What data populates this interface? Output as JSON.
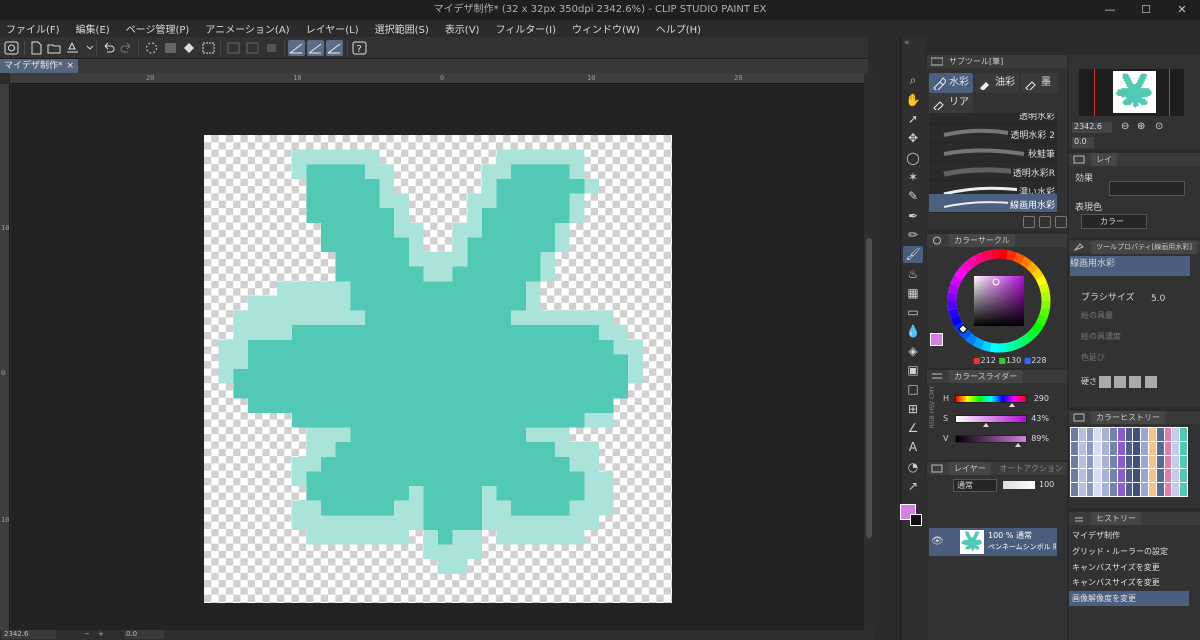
{
  "window": {
    "title": "マイデザ制作* (32 x 32px 350dpi 2342.6%)  - CLIP STUDIO PAINT EX",
    "minimize": "—",
    "maximize": "☐",
    "close": "✕"
  },
  "menu": [
    "ファイル(F)",
    "編集(E)",
    "ページ管理(P)",
    "アニメーション(A)",
    "レイヤー(L)",
    "選択範囲(S)",
    "表示(V)",
    "フィルター(I)",
    "ウィンドウ(W)",
    "ヘルプ(H)"
  ],
  "document_tab": {
    "label": "マイデザ制作*",
    "close": "×"
  },
  "rulers": {
    "horizontal": [
      "20",
      "10",
      "0",
      "10",
      "20"
    ],
    "vertical": [
      "10",
      "0",
      "10"
    ]
  },
  "status": {
    "zoom": "2342.6",
    "rotation": "0.0"
  },
  "colors": {
    "art": "#52c9b5",
    "art_edge": "#a9e3da",
    "accent": "#4b5f80",
    "current_color": "#d480e0"
  },
  "subtool_panel": {
    "title": "サブツール[筆]",
    "tabs": [
      "水彩",
      "油彩",
      "墨"
    ],
    "tab2": [
      "リアル"
    ],
    "brushes": [
      "透明水彩",
      "透明水彩 2",
      "秋鮭筆",
      "透明水彩R",
      "濃い水彩",
      "線画用水彩"
    ],
    "selected_brush": "線画用水彩"
  },
  "navigator": {
    "zoom": "2342.6",
    "angle": "0.0"
  },
  "layer_property": {
    "tab": "レイ",
    "effect_label": "効果",
    "expression_label": "表現色",
    "expression_value": "カラー"
  },
  "color_circle": {
    "title": "カラーサークル",
    "r": "212",
    "g": "130",
    "b": "228"
  },
  "tool_property": {
    "title": "ツールプロパティ[線画用水彩]",
    "brush_name": "線画用水彩",
    "brush_size_label": "ブラシサイズ",
    "brush_size_value": "5.0",
    "paint_amount": "絵の具量",
    "paint_density": "絵の具濃度",
    "color_stretch": "色延び",
    "hardness": "硬さ"
  },
  "color_slider": {
    "title": "カラースライダー",
    "h_label": "H",
    "h_value": "290",
    "s_label": "S",
    "s_value": "43%",
    "v_label": "V",
    "v_value": "89%",
    "h_fraction": 0.806,
    "s_fraction": 0.43,
    "v_fraction": 0.89,
    "side_tabs": "RGB HSV CMY"
  },
  "color_history": {
    "title": "カラーヒストリー"
  },
  "layer_panel": {
    "title": "レイヤー",
    "tab2": "オートアクション",
    "blend_mode": "通常",
    "opacity": "100",
    "layer_info": "100 % 通常",
    "layer_name": "ペンネームシンボル 貼り"
  },
  "history_panel": {
    "title": "ヒストリー",
    "items": [
      "マイデザ制作",
      "グリッド・ルーラーの設定",
      "キャンバスサイズを変更",
      "キャンバスサイズを変更",
      "画像解像度を変更"
    ],
    "selected_index": 4
  },
  "tools": [
    "zoom-icon",
    "hand-icon",
    "operation-icon",
    "move-icon",
    "lasso-icon",
    "auto-select-icon",
    "eyedropper-icon",
    "pen-icon",
    "pencil-icon",
    "brush-icon",
    "airbrush-icon",
    "decoration-icon",
    "eraser-icon",
    "blend-icon",
    "fill-icon",
    "gradient-icon",
    "figure-icon",
    "frame-icon",
    "ruler-icon",
    "text-icon",
    "balloon-icon",
    "correct-line-icon"
  ]
}
